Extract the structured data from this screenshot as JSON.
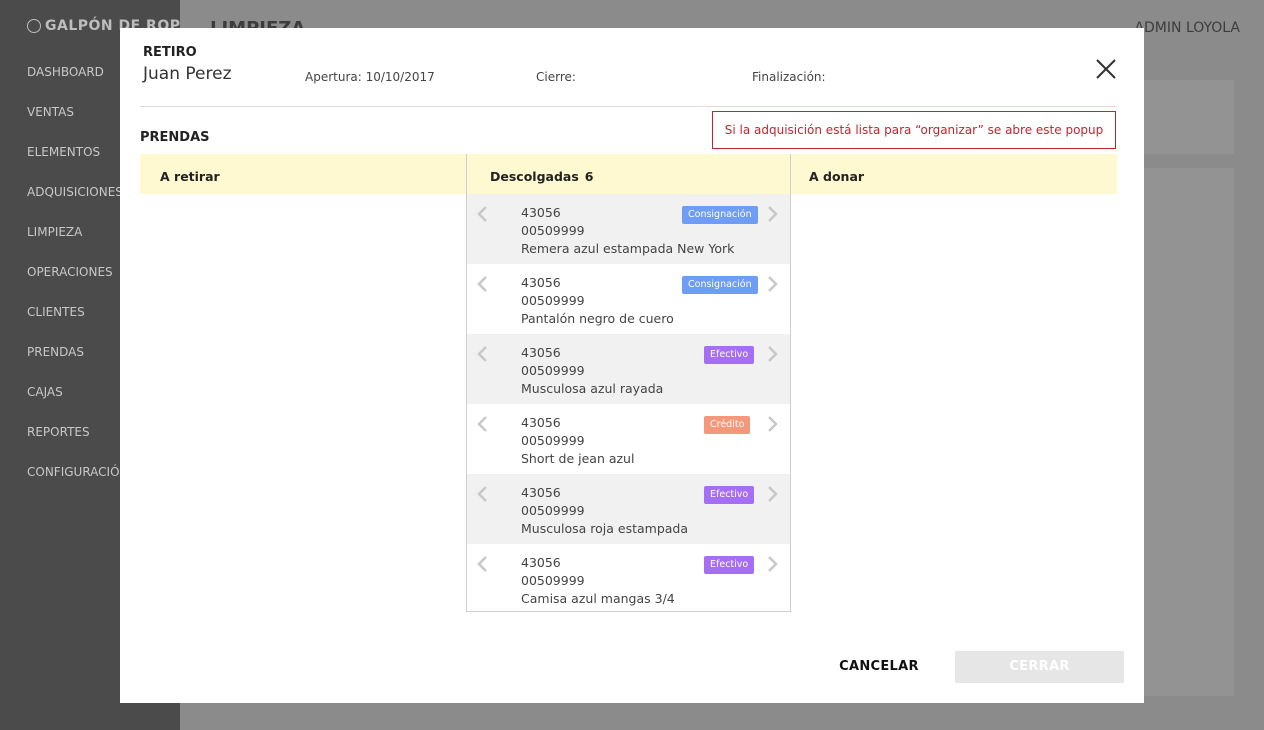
{
  "app": {
    "brand": "GALPÓN DE ROPA",
    "page_title": "LIMPIEZA",
    "user": "ADMIN LOYOLA"
  },
  "sidebar": {
    "items": [
      {
        "label": "DASHBOARD"
      },
      {
        "label": "VENTAS"
      },
      {
        "label": "ELEMENTOS"
      },
      {
        "label": "ADQUISICIONES"
      },
      {
        "label": "LIMPIEZA"
      },
      {
        "label": "OPERACIONES"
      },
      {
        "label": "CLIENTES"
      },
      {
        "label": "PRENDAS"
      },
      {
        "label": "CAJAS"
      },
      {
        "label": "REPORTES"
      },
      {
        "label": "CONFIGURACIÓN"
      }
    ]
  },
  "modal": {
    "type": "RETIRO",
    "name": "Juan Perez",
    "apertura": "Apertura: 10/10/2017",
    "cierre": "Cierre:",
    "finalizacion": "Finalización:",
    "section": "PRENDAS",
    "note": "Si la adquisición está lista para “organizar” se abre este popup",
    "columns": {
      "left": "A retirar",
      "middle": "Descolgadas",
      "middle_count": "6",
      "right": "A donar"
    },
    "items": [
      {
        "id": "43056",
        "code": "00509999",
        "desc": "Remera azul estampada New York",
        "badge": "Consignación",
        "badge_color": "#6f9cf5"
      },
      {
        "id": "43056",
        "code": "00509999",
        "desc": "Pantalón negro de cuero",
        "badge": "Consignación",
        "badge_color": "#6f9cf5"
      },
      {
        "id": "43056",
        "code": "00509999",
        "desc": "Musculosa azul rayada",
        "badge": "Efectivo",
        "badge_color": "#a66ef5"
      },
      {
        "id": "43056",
        "code": "00509999",
        "desc": "Short de jean azul",
        "badge": "Crédito",
        "badge_color": "#f5987a"
      },
      {
        "id": "43056",
        "code": "00509999",
        "desc": "Musculosa roja estampada",
        "badge": "Efectivo",
        "badge_color": "#a66ef5"
      },
      {
        "id": "43056",
        "code": "00509999",
        "desc": "Camisa azul mangas 3/4",
        "badge": "Efectivo",
        "badge_color": "#a66ef5"
      }
    ],
    "cancel_label": "CANCELAR",
    "close_label": "CERRAR"
  }
}
